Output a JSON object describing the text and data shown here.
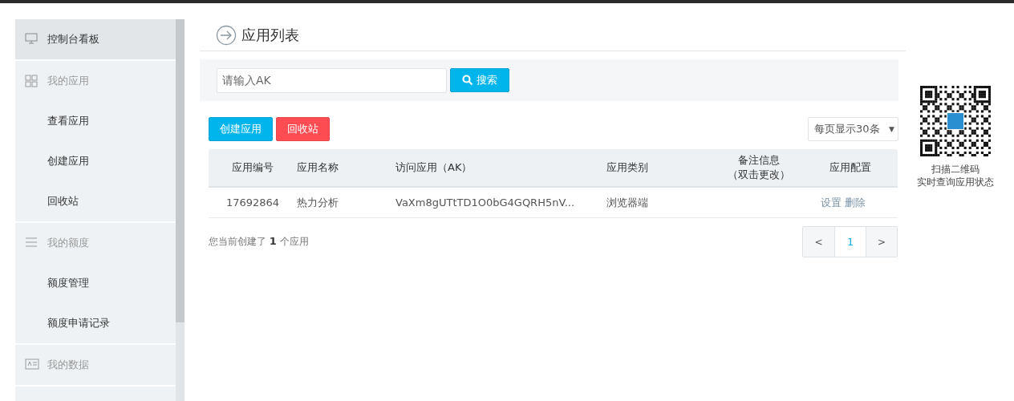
{
  "sidebar": {
    "items": [
      {
        "label": "控制台看板",
        "kind": "link",
        "selected": true
      },
      {
        "label": "我的应用",
        "kind": "group",
        "children": [
          {
            "label": "查看应用"
          },
          {
            "label": "创建应用"
          },
          {
            "label": "回收站"
          }
        ]
      },
      {
        "label": "我的额度",
        "kind": "group",
        "children": [
          {
            "label": "额度管理"
          },
          {
            "label": "额度申请记录"
          }
        ]
      },
      {
        "label": "我的数据",
        "kind": "group"
      }
    ]
  },
  "page_title": "应用列表",
  "search": {
    "placeholder": "请输入AK",
    "button": "搜索"
  },
  "actions": [
    {
      "label": "创建应用",
      "kind": "primary"
    },
    {
      "label": "回收站",
      "kind": "danger"
    }
  ],
  "page_size": {
    "value": "每页显示30条",
    "caret": "▼"
  },
  "table": {
    "columns": [
      {
        "label": "应用编号"
      },
      {
        "label": "应用名称"
      },
      {
        "label": "访问应用（AK）"
      },
      {
        "label": "应用类别"
      },
      {
        "label": "备注信息",
        "hint": "（双击更改）"
      },
      {
        "label": "应用配置"
      }
    ],
    "rows": [
      {
        "id": "17692864",
        "name": "热力分析",
        "ak": "VaXm8gUTtTD1O0bG4GQRH5nV...",
        "category": "浏览器端",
        "links": [
          "设置",
          "删除"
        ]
      }
    ]
  },
  "summary": {
    "prefix": "您当前创建了",
    "count": "1",
    "suffix": "个应用"
  },
  "pagination": {
    "prev": "<",
    "pages": [
      {
        "label": "1",
        "selected": true
      }
    ],
    "next": ">"
  },
  "qr": {
    "caption": [
      "扫描二维码",
      "实时查询应用状态"
    ]
  }
}
